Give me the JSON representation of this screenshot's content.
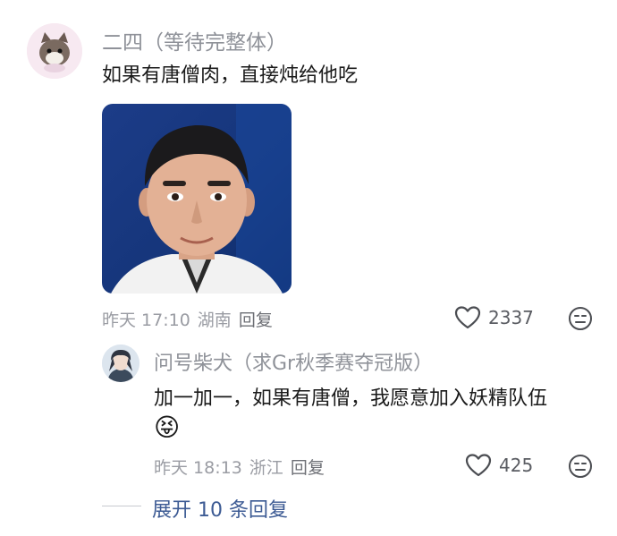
{
  "comment": {
    "author": "二四（等待完整体）",
    "text": "如果有唐僧肉，直接炖给他吃",
    "meta": {
      "time": "昨天 17:10",
      "location": "湖南",
      "reply_label": "回复"
    },
    "likes": "2337"
  },
  "reply": {
    "author": "问号柴犬（求Gr秋季赛夺冠版）",
    "text": "加一加一，如果有唐僧，我愿意加入妖精队伍",
    "emoji": "😝",
    "meta": {
      "time": "昨天 18:13",
      "location": "浙江",
      "reply_label": "回复"
    },
    "likes": "425"
  },
  "expand_label": "展开 10 条回复"
}
